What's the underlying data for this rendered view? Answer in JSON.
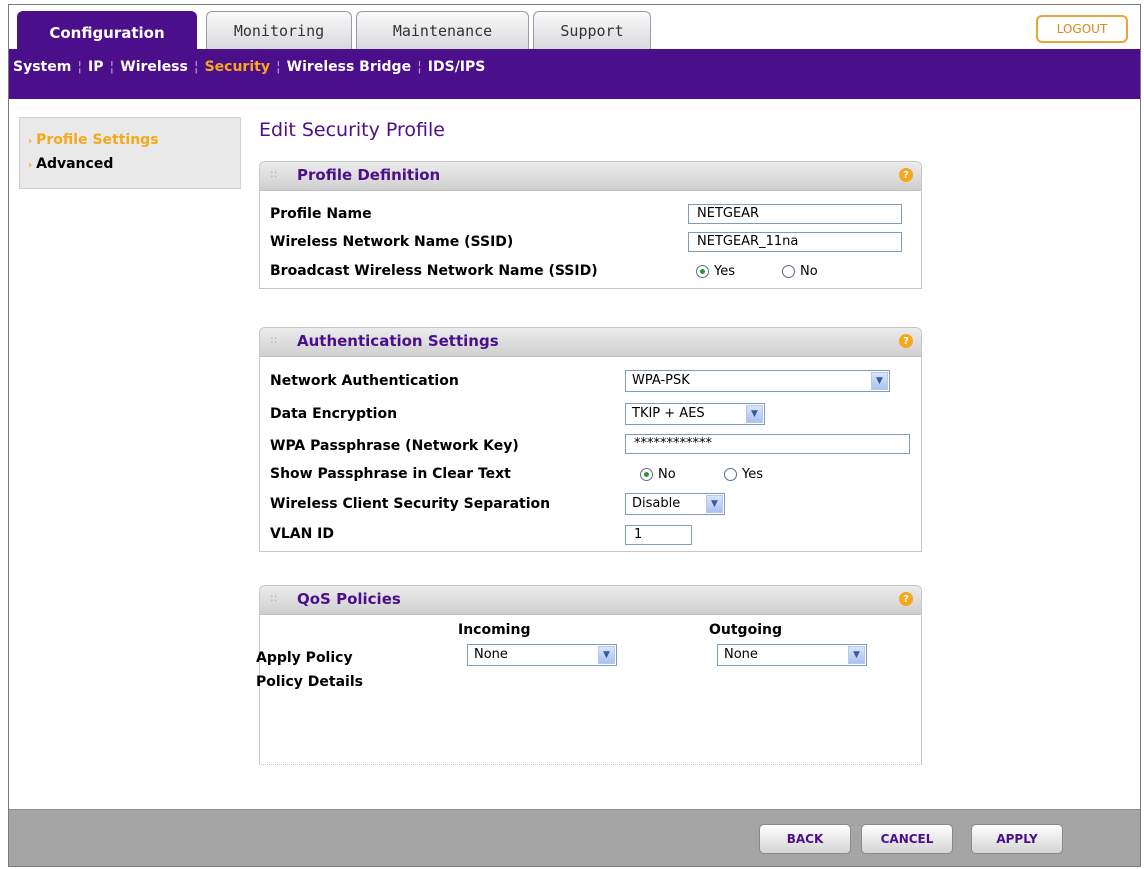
{
  "tabs": [
    {
      "label": "Configuration"
    },
    {
      "label": "Monitoring"
    },
    {
      "label": "Maintenance"
    },
    {
      "label": "Support"
    }
  ],
  "logout_label": "LOGOUT",
  "subnav": [
    "System",
    "IP",
    "Wireless",
    "Security",
    "Wireless Bridge",
    "IDS/IPS"
  ],
  "sidebar": [
    "Profile Settings",
    "Advanced"
  ],
  "page_title": "Edit Security Profile",
  "profile_definition": {
    "title": "Profile Definition",
    "profile_name_label": "Profile Name",
    "profile_name_value": "NETGEAR",
    "ssid_label": "Wireless Network Name (SSID)",
    "ssid_value": "NETGEAR_11na",
    "broadcast_label": "Broadcast Wireless Network Name (SSID)",
    "broadcast_yes": "Yes",
    "broadcast_no": "No",
    "broadcast_selected": "Yes"
  },
  "authentication": {
    "title": "Authentication Settings",
    "network_auth_label": "Network Authentication",
    "network_auth_value": "WPA-PSK",
    "data_enc_label": "Data Encryption",
    "data_enc_value": "TKIP + AES",
    "passphrase_label": "WPA Passphrase (Network Key)",
    "passphrase_value": "************",
    "show_pass_label": "Show Passphrase in Clear Text",
    "show_no": "No",
    "show_yes": "Yes",
    "show_selected": "No",
    "separation_label": "Wireless Client Security Separation",
    "separation_value": "Disable",
    "vlan_label": "VLAN ID",
    "vlan_value": "1"
  },
  "qos": {
    "title": "QoS Policies",
    "incoming_header": "Incoming",
    "outgoing_header": "Outgoing",
    "apply_label": "Apply Policy",
    "incoming_value": "None",
    "outgoing_value": "None",
    "details_label": "Policy Details"
  },
  "footer": {
    "back": "BACK",
    "cancel": "CANCEL",
    "apply": "APPLY"
  },
  "help_glyph": "?"
}
